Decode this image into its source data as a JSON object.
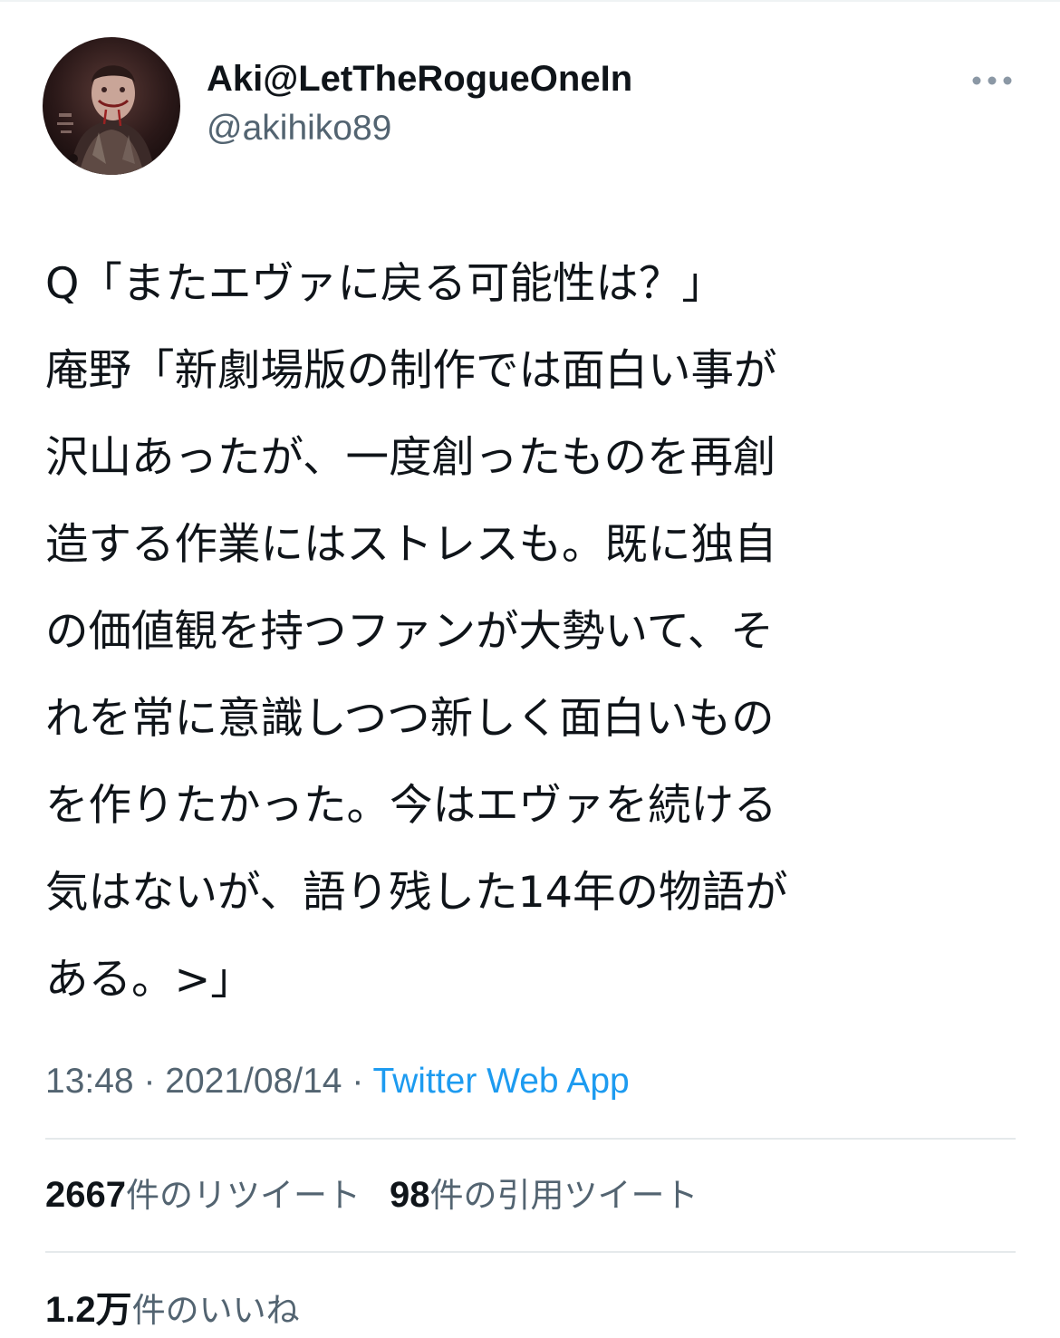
{
  "tweet": {
    "author": {
      "display_name": "Aki@LetTheRogueOneIn",
      "handle": "@akihiko89"
    },
    "more_icon": "more-horizontal-icon",
    "text": "Q「またエヴァに戻る可能性は？」\n庵野「新劇場版の制作では面白い事が\n沢山あったが、一度創ったものを再創\n造する作業にはストレスも。既に独自\nの価値観を持つファンが大勢いて、そ\nれを常に意識しつつ新しく面白いもの\nを作りたかった。今はエヴァを続ける\n気はないが、語り残した14年の物語が\nある。>」",
    "time": "13:48",
    "date": "2021/08/14",
    "separator": " · ",
    "source": "Twitter Web App",
    "stats": {
      "retweets": {
        "count": "2667",
        "label": "件のリツイート"
      },
      "quotes": {
        "count": "98",
        "label": "件の引用ツイート"
      },
      "likes": {
        "count": "1.2万",
        "label": "件のいいね"
      }
    }
  },
  "colors": {
    "text": "#0f1419",
    "secondary": "#536471",
    "link": "#1d9bf0",
    "divider": "#e5e9eb"
  }
}
